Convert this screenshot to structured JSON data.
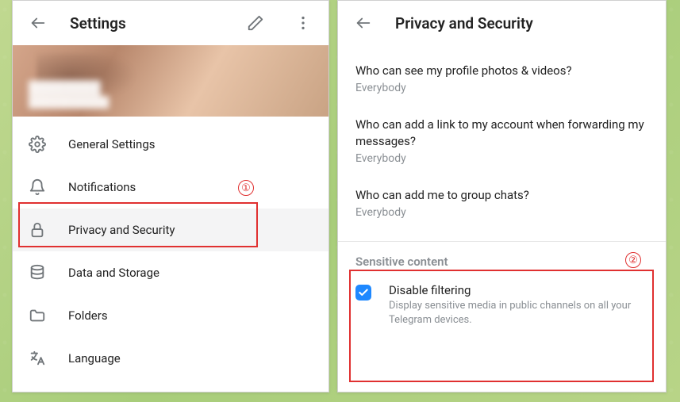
{
  "left": {
    "title": "Settings",
    "menu": [
      {
        "icon": "gear",
        "label": "General Settings"
      },
      {
        "icon": "bell",
        "label": "Notifications"
      },
      {
        "icon": "lock",
        "label": "Privacy and Security",
        "active": true
      },
      {
        "icon": "database",
        "label": "Data and Storage"
      },
      {
        "icon": "folder",
        "label": "Folders"
      },
      {
        "icon": "language",
        "label": "Language"
      }
    ]
  },
  "right": {
    "title": "Privacy and Security",
    "privacy": [
      {
        "q": "Who can see my profile photos & videos?",
        "v": "Everybody"
      },
      {
        "q": "Who can add a link to my account when forwarding my messages?",
        "v": "Everybody"
      },
      {
        "q": "Who can add me to group chats?",
        "v": "Everybody"
      }
    ],
    "section_title": "Sensitive content",
    "disable_filtering": {
      "title": "Disable filtering",
      "desc": "Display sensitive media in public channels on all your Telegram devices.",
      "checked": true
    }
  },
  "annotations": {
    "label1": "①",
    "label2": "②"
  }
}
